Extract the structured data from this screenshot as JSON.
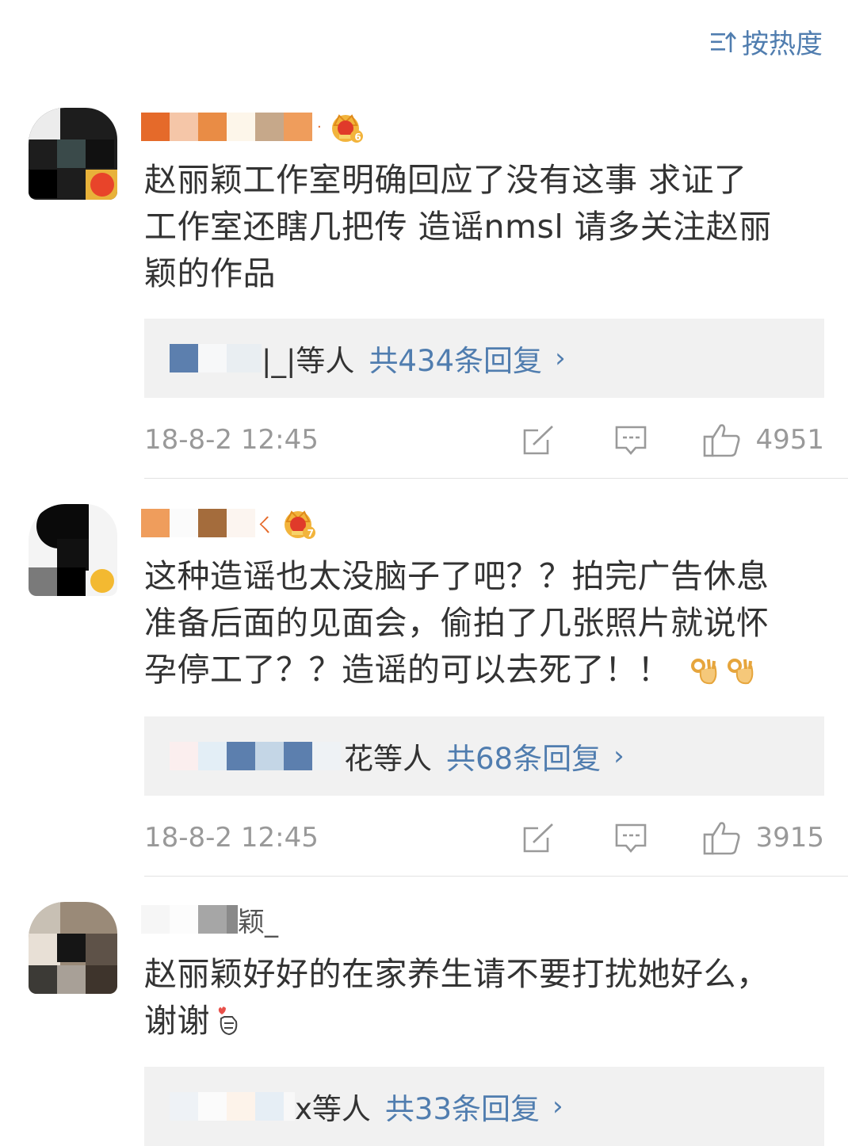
{
  "sort": {
    "label": "按热度",
    "icon": "sort-icon"
  },
  "comments": [
    {
      "text_lines": [
        "赵丽颖工作室明确回应了没有这事 求证了",
        "工作室还瞎几把传 造谣nmsl 请多关注赵丽",
        "颖的作品"
      ],
      "crown_level": "6",
      "reply_names_suffix": "|_|等人",
      "reply_count": "共434条回复",
      "time": "18-8-2 12:45",
      "likes": "4951"
    },
    {
      "text_lines": [
        "这种造谣也太没脑子了吧？？拍完广告休息",
        "准备后面的见面会，偷拍了几张照片就说怀",
        "孕停工了？？造谣的可以去死了！！"
      ],
      "crown_level": "7",
      "username_suffix": "ㄑ",
      "reply_names_suffix": "花等人",
      "reply_count": "共68条回复",
      "time": "18-8-2 12:45",
      "likes": "3915"
    },
    {
      "text_lines": [
        "赵丽颖好好的在家养生请不要打扰她好么，",
        "谢谢"
      ],
      "username_suffix": "颖_",
      "reply_names_suffix": "x等人",
      "reply_count": "共33条回复"
    }
  ],
  "chevron": "›",
  "colors": {
    "link": "#507daf",
    "meta": "#999999",
    "reply_bg": "#f1f1f1"
  }
}
